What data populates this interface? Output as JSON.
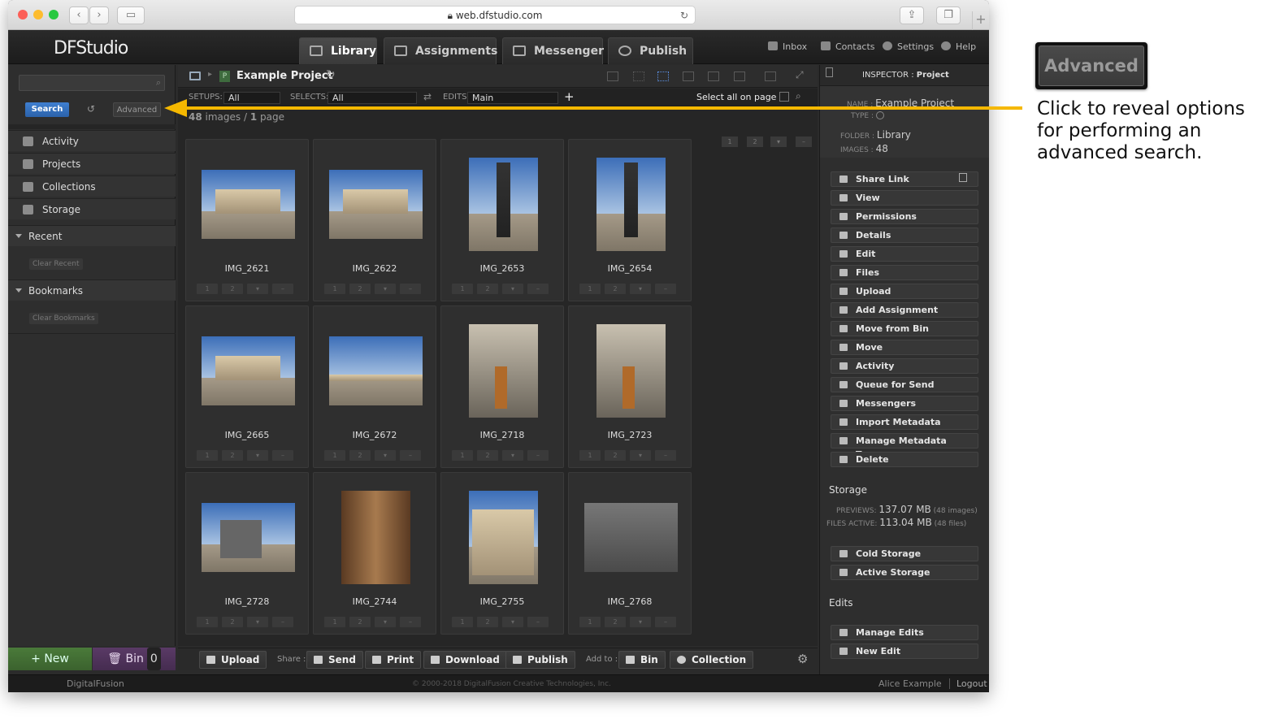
{
  "browser": {
    "url": "web.dfstudio.com"
  },
  "app": {
    "logo": "DFStudio",
    "tabs": [
      {
        "label": "Library",
        "active": true
      },
      {
        "label": "Assignments"
      },
      {
        "label": "Messenger"
      },
      {
        "label": "Publish"
      }
    ],
    "top_links": {
      "inbox": "Inbox",
      "contacts": "Contacts",
      "settings": "Settings",
      "help": "Help"
    }
  },
  "sidebar": {
    "search_label": "Search",
    "advanced_label": "Advanced",
    "nav": [
      "Activity",
      "Projects",
      "Collections",
      "Storage"
    ],
    "recent": {
      "title": "Recent",
      "clear": "Clear Recent"
    },
    "bookmarks": {
      "title": "Bookmarks",
      "clear": "Clear Bookmarks"
    },
    "new_label": "+ New",
    "bin_label": "Bin",
    "bin_count": "0"
  },
  "main": {
    "project_badge": "P",
    "project_title": "Example Project",
    "setups_label": "SETUPS:",
    "setups_value": "All",
    "selects_label": "SELECTS:",
    "selects_value": "All",
    "edits_label": "EDITS:",
    "edits_value": "Main",
    "select_all": "Select all on page",
    "count_images": "48",
    "count_images_suffix": "images /",
    "count_pages": "1",
    "count_pages_suffix": "page",
    "page_chips": [
      "1",
      "2"
    ],
    "images": [
      "IMG_2621",
      "IMG_2622",
      "IMG_2653",
      "IMG_2654",
      "IMG_2665",
      "IMG_2672",
      "IMG_2718",
      "IMG_2723",
      "IMG_2728",
      "IMG_2744",
      "IMG_2755",
      "IMG_2768"
    ],
    "card_buttons": [
      "1",
      "2"
    ],
    "bottom": {
      "upload": "Upload",
      "share_label": "Share :",
      "send": "Send",
      "print": "Print",
      "download": "Download",
      "publish": "Publish",
      "addto_label": "Add to :",
      "bin": "Bin",
      "collection": "Collection"
    }
  },
  "inspector": {
    "header_label": "INSPECTOR :",
    "header_value": "Project",
    "name_label": "NAME :",
    "name_value": "Example Project",
    "type_label": "TYPE :",
    "folder_label": "FOLDER :",
    "folder_value": "Library",
    "images_label": "IMAGES :",
    "images_value": "48",
    "actions": [
      "Share Link",
      "View",
      "Permissions",
      "Details",
      "Edit",
      "Files",
      "Upload",
      "Add Assignment",
      "Move from Bin",
      "Move",
      "Activity",
      "Queue for Send",
      "Messengers",
      "Import Metadata",
      "Manage Metadata Terms",
      "Delete"
    ],
    "storage_title": "Storage",
    "previews_label": "PREVIEWS:",
    "previews_value": "137.07 MB",
    "previews_note": "(48 images)",
    "files_label": "FILES ACTIVE:",
    "files_value": "113.04 MB",
    "files_note": "(48 files)",
    "storage_actions": [
      "Cold Storage",
      "Active Storage"
    ],
    "edits_title": "Edits",
    "edits_actions": [
      "Manage Edits",
      "New Edit"
    ]
  },
  "footer": {
    "brand": "DigitalFusion",
    "copyright": "© 2000-2018 DigitalFusion Creative Technologies, Inc.",
    "user": "Alice Example",
    "logout": "Logout"
  },
  "callout": {
    "button_label": "Advanced",
    "text": "Click to reveal options for performing an advanced search.",
    "arrow_color": "#f5b800"
  }
}
